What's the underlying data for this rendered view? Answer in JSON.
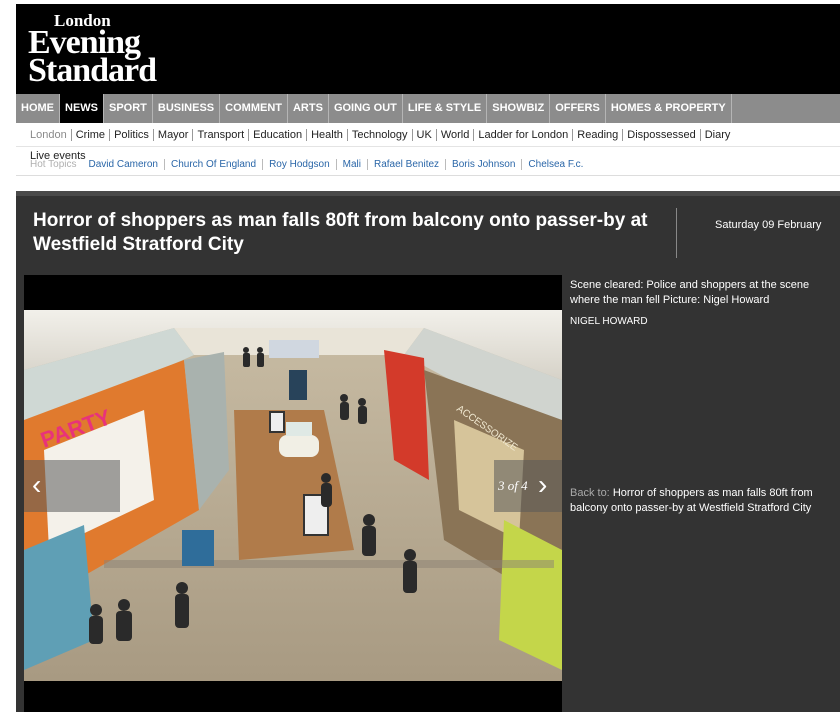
{
  "logo": {
    "line1": "London",
    "line2": "Evening",
    "line3": "Standard"
  },
  "main_nav": [
    {
      "label": "HOME",
      "active": false
    },
    {
      "label": "NEWS",
      "active": true
    },
    {
      "label": "SPORT",
      "active": false
    },
    {
      "label": "BUSINESS",
      "active": false
    },
    {
      "label": "COMMENT",
      "active": false
    },
    {
      "label": "ARTS",
      "active": false
    },
    {
      "label": "GOING OUT",
      "active": false
    },
    {
      "label": "LIFE & STYLE",
      "active": false
    },
    {
      "label": "SHOWBIZ",
      "active": false
    },
    {
      "label": "OFFERS",
      "active": false
    },
    {
      "label": "HOMES & PROPERTY",
      "active": false
    }
  ],
  "sub_nav": [
    {
      "label": "London",
      "current": true
    },
    {
      "label": "Crime",
      "current": false
    },
    {
      "label": "Politics",
      "current": false
    },
    {
      "label": "Mayor",
      "current": false
    },
    {
      "label": "Transport",
      "current": false
    },
    {
      "label": "Education",
      "current": false
    },
    {
      "label": "Health",
      "current": false
    },
    {
      "label": "Technology",
      "current": false
    },
    {
      "label": "UK",
      "current": false
    },
    {
      "label": "World",
      "current": false
    },
    {
      "label": "Ladder for London",
      "current": false
    },
    {
      "label": "Reading",
      "current": false
    },
    {
      "label": "Dispossessed",
      "current": false
    },
    {
      "label": "Diary",
      "current": false
    }
  ],
  "live_events": "Live events",
  "hot_topics": {
    "label": "Hot Topics",
    "items": [
      "David Cameron",
      "Church Of England",
      "Roy Hodgson",
      "Mali",
      "Rafael Benitez",
      "Boris Johnson",
      "Chelsea F.c."
    ]
  },
  "article": {
    "headline": "Horror of shoppers as man falls 80ft from balcony onto passer-by at Westfield Stratford City",
    "date": "Saturday 09 February"
  },
  "gallery": {
    "counter": "3 of 4",
    "prev_icon": "chevron-left-icon",
    "next_icon": "chevron-right-icon",
    "photo_signs": {
      "party": "PARTY",
      "store": "ACCESSORIZE"
    },
    "caption": "Scene cleared: Police and shoppers at the scene where the man fell Picture: Nigel Howard",
    "credit": "NIGEL HOWARD",
    "back_label": "Back to:",
    "back_link": "Horror of shoppers as man falls 80ft from balcony onto passer-by at Westfield Stratford City"
  },
  "colors": {
    "panel_bg": "#333333",
    "nav_bg": "#8c8c8c",
    "link_blue": "#2a66a8"
  }
}
